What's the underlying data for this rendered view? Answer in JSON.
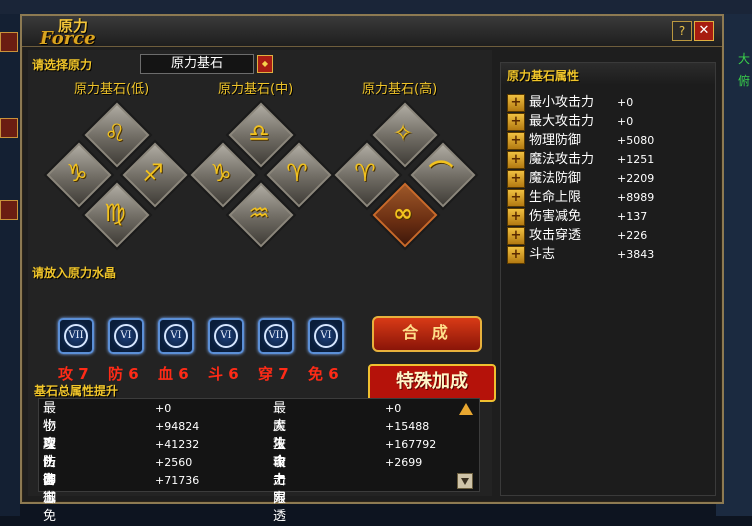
{
  "window": {
    "title_cn": "原力",
    "title_en": "Force",
    "help_label": "?",
    "close_label": "✕"
  },
  "background": {
    "right_text": [
      "大",
      "俯"
    ]
  },
  "selector": {
    "label": "请选择原力",
    "dropdown_value": "原力基石"
  },
  "tiers": [
    {
      "label": "原力基石(低)",
      "glyphs": [
        "♌",
        "♑",
        "♐",
        "♍"
      ]
    },
    {
      "label": "原力基石(中)",
      "glyphs": [
        "♎",
        "♑",
        "♈",
        "♒"
      ]
    },
    {
      "label": "原力基石(高)",
      "glyphs": [
        "✧",
        "♈",
        "⌒",
        "∞"
      ]
    }
  ],
  "crystals": {
    "label": "请放入原力水晶",
    "slots": [
      {
        "roman": "VII",
        "stat": "攻 7"
      },
      {
        "roman": "VI",
        "stat": "防 6"
      },
      {
        "roman": "VI",
        "stat": "血 6"
      },
      {
        "roman": "VI",
        "stat": "斗 6"
      },
      {
        "roman": "VII",
        "stat": "穿 7"
      },
      {
        "roman": "VI",
        "stat": "免 6"
      }
    ]
  },
  "buttons": {
    "compose": "合 成",
    "special": "特殊加成"
  },
  "totals": {
    "label": "基石总属性提升",
    "rows": [
      {
        "name1": "最小攻击力",
        "val1": "+0",
        "name2": "最大攻击力",
        "val2": "+0"
      },
      {
        "name1": "物理防御",
        "val1": "+94824",
        "name2": "魔法攻击力",
        "val2": "+15488"
      },
      {
        "name1": "魔法防御",
        "val1": "+41232",
        "name2": "生命上限",
        "val2": "+167792"
      },
      {
        "name1": "伤害减免",
        "val1": "+2560",
        "name2": "攻击穿透",
        "val2": "+2699"
      },
      {
        "name1": "斗志",
        "val1": "+71736",
        "name2": "",
        "val2": ""
      }
    ]
  },
  "attributes": {
    "title": "原力基石属性",
    "rows": [
      {
        "name": "最小攻击力",
        "value": "+0"
      },
      {
        "name": "最大攻击力",
        "value": "+0"
      },
      {
        "name": "物理防御",
        "value": "+5080"
      },
      {
        "name": "魔法攻击力",
        "value": "+1251"
      },
      {
        "name": "魔法防御",
        "value": "+2209"
      },
      {
        "name": "生命上限",
        "value": "+8989"
      },
      {
        "name": "伤害减免",
        "value": "+137"
      },
      {
        "name": "攻击穿透",
        "value": "+226"
      },
      {
        "name": "斗志",
        "value": "+3843"
      }
    ]
  },
  "colors": {
    "accent_gold": "#f0c52a",
    "stat_red": "#ff2b17",
    "button_red": "#b5120a"
  }
}
